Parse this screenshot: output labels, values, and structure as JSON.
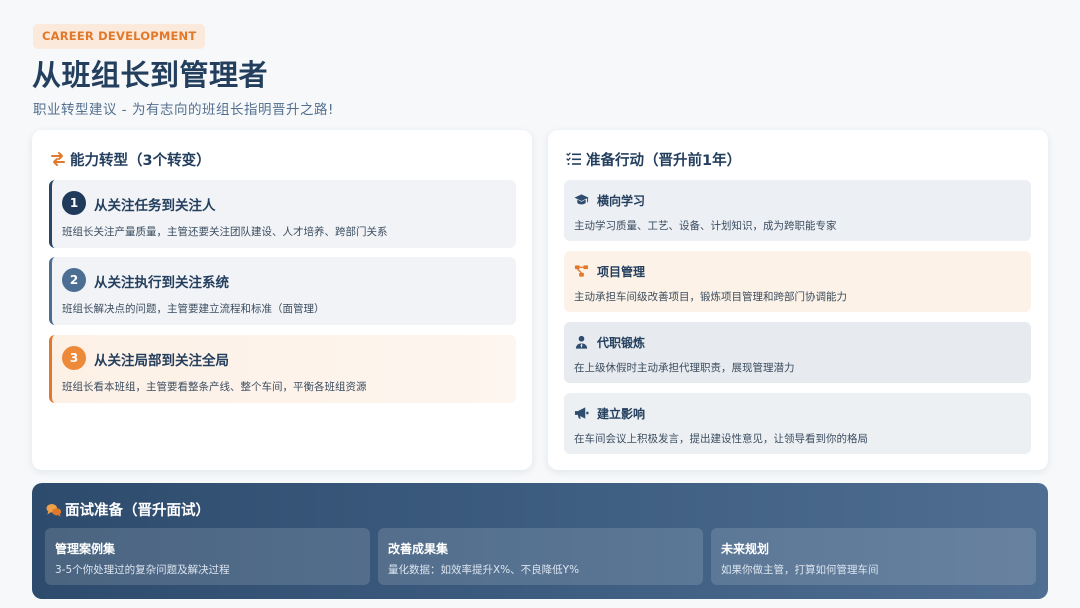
{
  "header": {
    "tag": "CAREER DEVELOPMENT",
    "title": "从班组长到管理者",
    "subtitle": "职业转型建议 - 为有志向的班组长指明晋升之路!"
  },
  "shifts": {
    "heading": "能力转型（3个转变）",
    "items": [
      {
        "num": "1",
        "title": "从关注任务到关注人",
        "desc": "班组长关注产量质量，主管还要关注团队建设、人才培养、跨部门关系"
      },
      {
        "num": "2",
        "title": "从关注执行到关注系统",
        "desc": "班组长解决点的问题，主管要建立流程和标准（面管理）"
      },
      {
        "num": "3",
        "title": "从关注局部到关注全局",
        "desc": "班组长看本班组，主管要看整条产线、整个车间，平衡各班组资源"
      }
    ]
  },
  "actions": {
    "heading": "准备行动（晋升前1年）",
    "items": [
      {
        "icon": "graduation-cap-icon",
        "title": "横向学习",
        "desc": "主动学习质量、工艺、设备、计划知识，成为跨职能专家"
      },
      {
        "icon": "project-diagram-icon",
        "title": "项目管理",
        "desc": "主动承担车间级改善项目，锻炼项目管理和跨部门协调能力"
      },
      {
        "icon": "user-tie-icon",
        "title": "代职锻炼",
        "desc": "在上级休假时主动承担代理职责，展现管理潜力"
      },
      {
        "icon": "bullhorn-icon",
        "title": "建立影响",
        "desc": "在车间会议上积极发言，提出建设性意见，让领导看到你的格局"
      }
    ]
  },
  "interview": {
    "heading": "面试准备（晋升面试）",
    "items": [
      {
        "title": "管理案例集",
        "desc": "3-5个你处理过的复杂问题及解决过程"
      },
      {
        "title": "改善成果集",
        "desc": "量化数据：如效率提升X%、不良降低Y%"
      },
      {
        "title": "未来规划",
        "desc": "如果你做主管，打算如何管理车间"
      }
    ]
  },
  "colors": {
    "accent": "#e2782a",
    "navy": "#243f5e",
    "banner": "#3e5e82"
  }
}
